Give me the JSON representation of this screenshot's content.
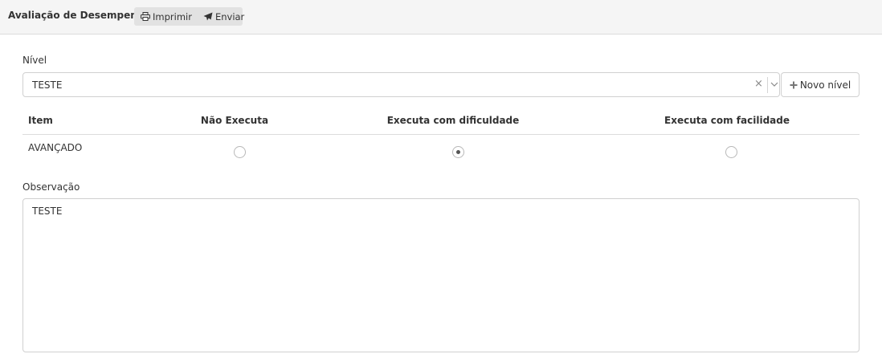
{
  "toolbar": {
    "title": "Avaliação de Desempenho",
    "print_label": "Imprimir",
    "send_label": "Enviar"
  },
  "form": {
    "nivel_label": "Nível",
    "nivel_value": "TESTE",
    "clear_symbol": "×",
    "new_level_label": "Novo nível",
    "observacao_label": "Observação",
    "observacao_value": "TESTE"
  },
  "table": {
    "columns": [
      "Item",
      "Não Executa",
      "Executa com dificuldade",
      "Executa com facilidade"
    ],
    "rows": [
      {
        "item": "AVANÇADO",
        "selected": "Executa com dificuldade"
      }
    ]
  },
  "icons": {
    "print": "print-icon",
    "send": "paper-plane-icon",
    "plus": "plus-icon",
    "caret": "chevron-down-icon"
  }
}
